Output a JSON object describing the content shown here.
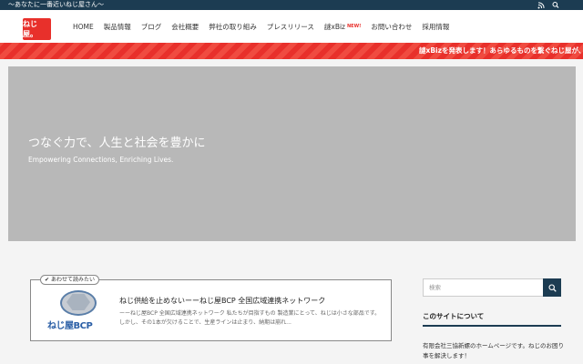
{
  "topbar": {
    "tagline": "〜あなたに一番近いねじ屋さん〜",
    "icons": [
      "rss-icon",
      "search-icon"
    ]
  },
  "header": {
    "logo_text": "ねじ屋。",
    "nav": [
      {
        "label": "HOME"
      },
      {
        "label": "製品情報"
      },
      {
        "label": "ブログ"
      },
      {
        "label": "会社概要"
      },
      {
        "label": "弊社の取り組み"
      },
      {
        "label": "プレスリリース"
      },
      {
        "label": "謎xBiz",
        "badge": "NEW!"
      },
      {
        "label": "お問い合わせ"
      },
      {
        "label": "採用情報"
      }
    ]
  },
  "ticker": {
    "text": "謎xBizを発表します！あらゆるものを繋ぐねじ屋が、「謎"
  },
  "hero": {
    "title": "つなぐ力で、人生と社会を豊かに",
    "subtitle": "Empowering Connections, Enriching Lives."
  },
  "related": {
    "tag": "あわせて読みたい",
    "thumb_text": "ねじ屋BCP",
    "title": "ねじ供給を止めないーーねじ屋BCP 全国広域連携ネットワーク",
    "excerpt": "ーーねじ屋BCP 全国広域連携ネットワーク 私たちが目指すもの 製造業にとって、ねじは小さな部品です。しかし、その1本が欠けることで、生産ラインは止まり、納期は崩れ..."
  },
  "sidebar": {
    "search_placeholder": "検索",
    "about_title": "このサイトについて",
    "about_text": "有限会社三協新螺のホームページです。ねじのお困り事を解決します！"
  },
  "colors": {
    "navy": "#1c3c52",
    "accent_red": "#e8302b",
    "hero_gray": "#b8b8b8"
  }
}
